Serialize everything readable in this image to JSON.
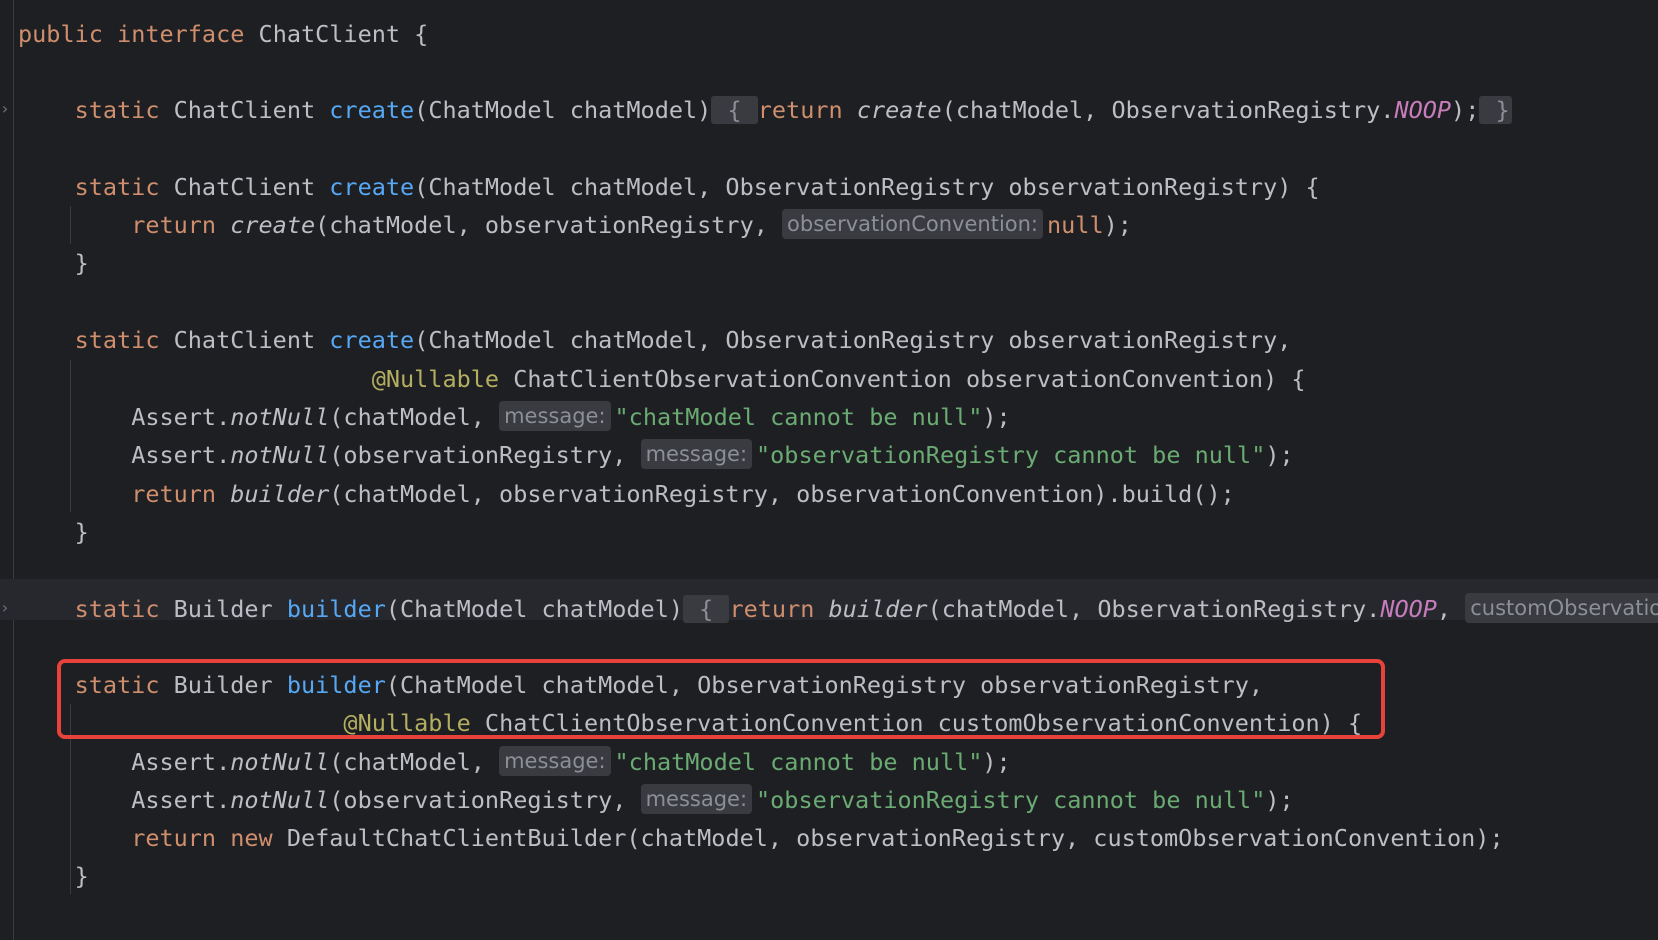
{
  "code": {
    "l0": {
      "a": "public",
      "b": "interface",
      "c": "ChatClient {"
    },
    "l1": {
      "a": "static",
      "b": "ChatClient",
      "c": "create",
      "d": "(ChatModel chatModel)",
      "e": "{",
      "f": "return",
      "g": "create",
      "h": "(chatModel, ObservationRegistry.",
      "i": "NOOP",
      "j": ");",
      "k": "}"
    },
    "l2": {
      "a": "static",
      "b": "ChatClient",
      "c": "create",
      "d": "(ChatModel chatModel, ObservationRegistry observationRegistry) {"
    },
    "l3": {
      "a": "return",
      "b": "create",
      "c": "(chatModel, observationRegistry,",
      "hint": "observationConvention:",
      "d": "null",
      "e": ");"
    },
    "l4": {
      "a": "}"
    },
    "l5": {
      "a": "static",
      "b": "ChatClient",
      "c": "create",
      "d": "(ChatModel chatModel, ObservationRegistry observationRegistry,"
    },
    "l6": {
      "a": "@Nullable",
      "b": "ChatClientObservationConvention observationConvention) {"
    },
    "l7": {
      "a": "Assert.",
      "b": "notNull",
      "c": "(chatModel,",
      "hint": "message:",
      "d": "\"chatModel cannot be null\"",
      "e": ");"
    },
    "l8": {
      "a": "Assert.",
      "b": "notNull",
      "c": "(observationRegistry,",
      "hint": "message:",
      "d": "\"observationRegistry cannot be null\"",
      "e": ");"
    },
    "l9": {
      "a": "return",
      "b": "builder",
      "c": "(chatModel, observationRegistry, observationConvention).build();"
    },
    "l10": {
      "a": "}"
    },
    "l11": {
      "a": "static",
      "b": "Builder",
      "c": "builder",
      "d": "(ChatModel chatModel)",
      "e": "{",
      "f": "return",
      "g": "builder",
      "h": "(chatModel, ObservationRegistry.",
      "i": "NOOP",
      "j": ",",
      "hint": "customObservationConvention:"
    },
    "l12": {
      "a": "static",
      "b": "Builder",
      "c": "builder",
      "d": "(ChatModel chatModel, ObservationRegistry observationRegistry,"
    },
    "l13": {
      "a": "@Nullable",
      "b": "ChatClientObservationConvention customObservationConvention) {"
    },
    "l14": {
      "a": "Assert.",
      "b": "notNull",
      "c": "(chatModel,",
      "hint": "message:",
      "d": "\"chatModel cannot be null\"",
      "e": ");"
    },
    "l15": {
      "a": "Assert.",
      "b": "notNull",
      "c": "(observationRegistry,",
      "hint": "message:",
      "d": "\"observationRegistry cannot be null\"",
      "e": ");"
    },
    "l16": {
      "a": "return",
      "b": "new",
      "c": "DefaultChatClientBuilder(chatModel, observationRegistry, customObservationConvention);"
    },
    "l17": {
      "a": "}"
    }
  },
  "gutter": {
    "fold_marker": "›"
  },
  "colors": {
    "background": "#1e1f22",
    "keyword": "#cf8e6d",
    "function": "#56a8f5",
    "string": "#6aab73",
    "annotation": "#b3ae60",
    "static_field": "#c77dbb",
    "highlight_box": "#e8433b"
  }
}
